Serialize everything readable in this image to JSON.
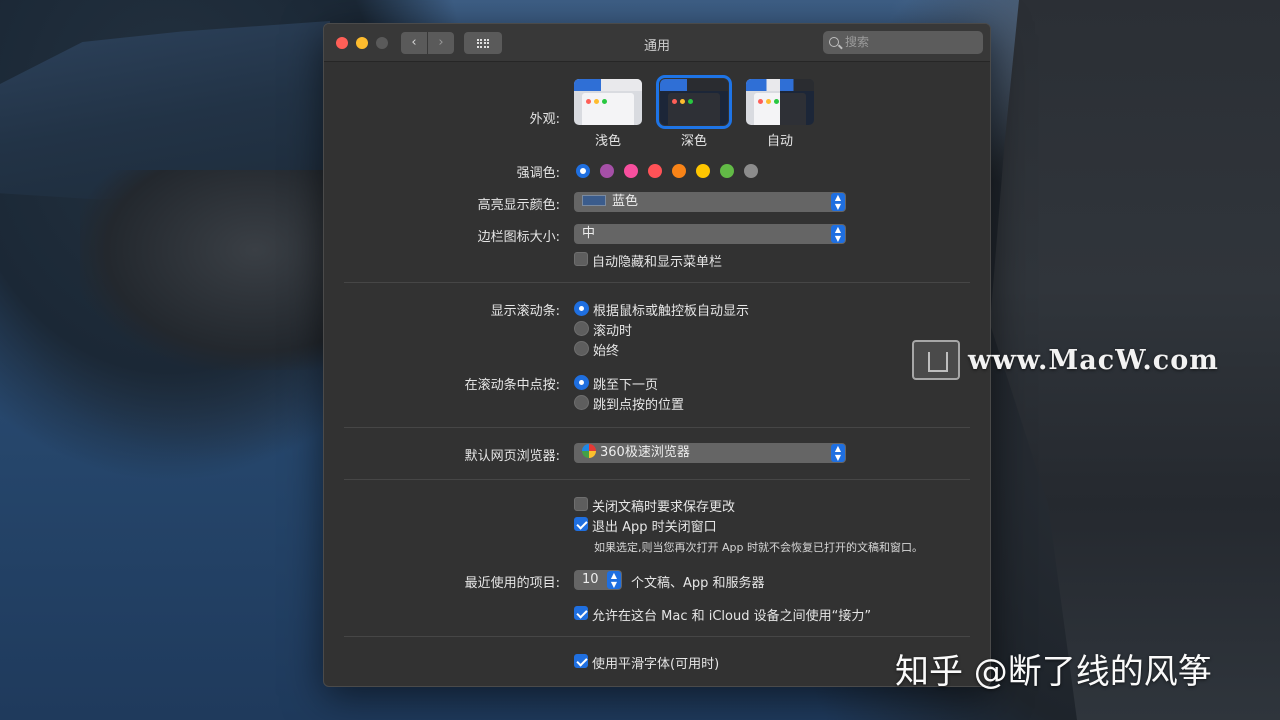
{
  "window": {
    "title": "通用",
    "search_placeholder": "搜索"
  },
  "appearance": {
    "label": "外观:",
    "options": [
      {
        "label": "浅色",
        "selected": false
      },
      {
        "label": "深色",
        "selected": true
      },
      {
        "label": "自动",
        "selected": false
      }
    ]
  },
  "accent": {
    "label": "强调色:",
    "colors": [
      "#1f6fe0",
      "#a550a7",
      "#f74f9e",
      "#ff5257",
      "#f88317",
      "#ffc600",
      "#62ba46",
      "#8c8c8c"
    ],
    "selected_index": 0
  },
  "highlight": {
    "label": "高亮显示颜色:",
    "value": "蓝色"
  },
  "sidebar_icon": {
    "label": "边栏图标大小:",
    "value": "中"
  },
  "menubar": {
    "label": "自动隐藏和显示菜单栏",
    "checked": false
  },
  "scrollbars": {
    "label": "显示滚动条:",
    "options": [
      {
        "label": "根据鼠标或触控板自动显示",
        "selected": true
      },
      {
        "label": "滚动时",
        "selected": false
      },
      {
        "label": "始终",
        "selected": false
      }
    ]
  },
  "scroll_click": {
    "label": "在滚动条中点按:",
    "options": [
      {
        "label": "跳至下一页",
        "selected": true
      },
      {
        "label": "跳到点按的位置",
        "selected": false
      }
    ]
  },
  "browser": {
    "label": "默认网页浏览器:",
    "value": "360极速浏览器"
  },
  "documents": {
    "ask_save": {
      "label": "关闭文稿时要求保存更改",
      "checked": false
    },
    "close_windows": {
      "label": "退出 App 时关闭窗口",
      "checked": true
    },
    "note": "如果选定,则当您再次打开 App 时就不会恢复已打开的文稿和窗口。"
  },
  "recent": {
    "label": "最近使用的项目:",
    "value": "10",
    "suffix": "个文稿、App 和服务器"
  },
  "handoff": {
    "label": "允许在这台 Mac 和 iCloud 设备之间使用“接力”",
    "checked": true
  },
  "font_smoothing": {
    "label": "使用平滑字体(可用时)",
    "checked": true
  },
  "watermarks": {
    "macw": "www.MacW.com",
    "zhihu": "知乎 @断了线的风筝"
  }
}
